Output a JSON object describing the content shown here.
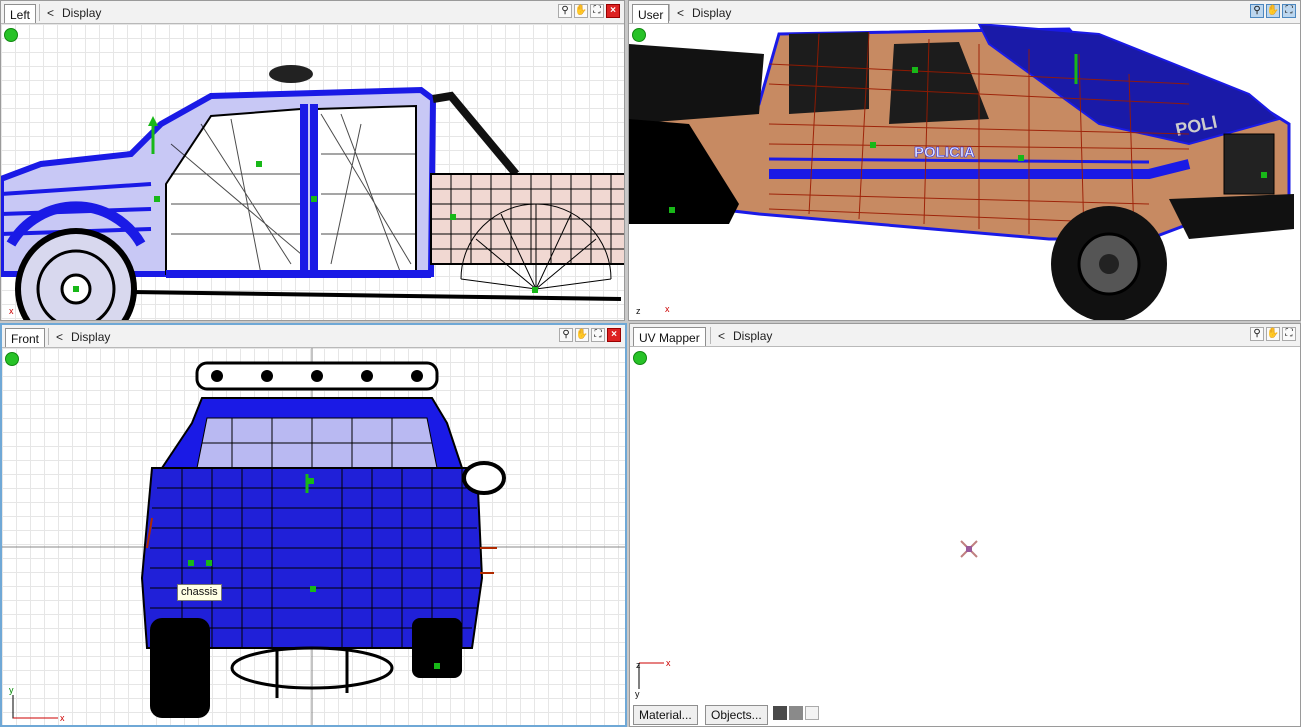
{
  "viewports": {
    "left": {
      "tab": "Left",
      "display_arrow": "<",
      "display": "Display",
      "axes": {
        "x": "x"
      }
    },
    "user": {
      "tab": "User",
      "display_arrow": "<",
      "display": "Display",
      "axes": {
        "x": "x",
        "z": "z"
      },
      "decal_text": "POLICIA"
    },
    "front": {
      "tab": "Front",
      "display_arrow": "<",
      "display": "Display",
      "axes": {
        "x": "x",
        "y": "y"
      },
      "tooltip": "chassis"
    },
    "uv": {
      "tab": "UV Mapper",
      "display_arrow": "<",
      "display": "Display",
      "axes": {
        "x": "x",
        "y": "y",
        "z": "z"
      }
    }
  },
  "bottom_bar": {
    "material_button": "Material...",
    "objects_button": "Objects..."
  },
  "icons": [
    "zoom-icon",
    "pan-hand-icon",
    "fit-view-icon",
    "close-icon"
  ],
  "colors": {
    "active_border": "#6fa8d6",
    "status_green": "#27c227",
    "wire_blue": "#1a1ae6",
    "wire_black": "#000000",
    "wire_red": "#b02a00"
  }
}
